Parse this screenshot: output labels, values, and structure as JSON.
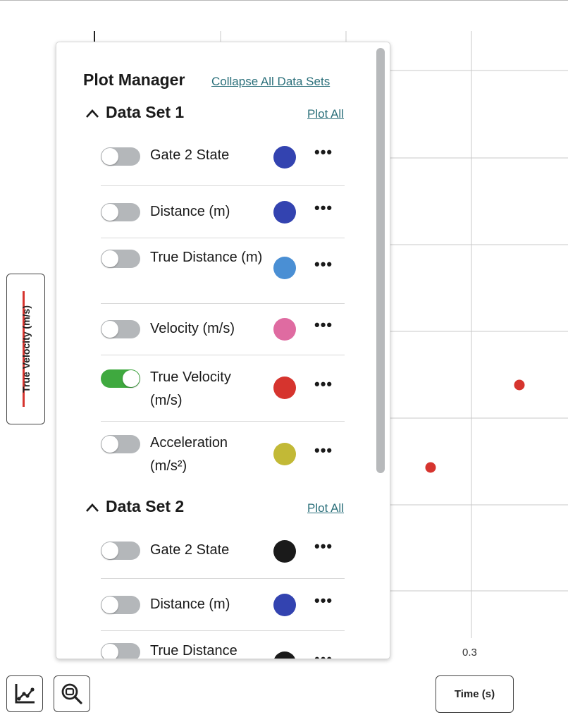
{
  "plot": {
    "x_tick_label": "0.3",
    "y_axis_label": "True Velocity (m/s)",
    "x_axis_label": "Time (s)",
    "series_color": "#d6342e",
    "point_color": "#d6342e"
  },
  "chart_data": {
    "type": "scatter",
    "xlabel": "Time (s)",
    "ylabel": "True Velocity (m/s)",
    "x_ticks": [
      "0.3"
    ],
    "series": [
      {
        "name": "True Velocity (m/s)",
        "color": "#d6342e",
        "points": [
          {
            "x": 0.28
          },
          {
            "x": 0.32
          }
        ]
      }
    ]
  },
  "plot_manager": {
    "title": "Plot Manager",
    "collapse_all_label": "Collapse All Data Sets",
    "datasets": [
      {
        "name": "Data Set 1",
        "plot_all_label": "Plot All",
        "expanded": true,
        "rows": [
          {
            "label": "Gate 2 State",
            "color": "#3343b0",
            "on": false
          },
          {
            "label": "Distance (m)",
            "color": "#3343b0",
            "on": false
          },
          {
            "label": "True Distance (m)",
            "color": "#4a8fd4",
            "on": false
          },
          {
            "label": "Velocity (m/s)",
            "color": "#df6ba1",
            "on": false
          },
          {
            "label": "True Velocity (m/s)",
            "color": "#d6342e",
            "on": true
          },
          {
            "label": "Acceleration (m/s²)",
            "color": "#c2b936",
            "on": false
          }
        ]
      },
      {
        "name": "Data Set 2",
        "plot_all_label": "Plot All",
        "expanded": true,
        "rows": [
          {
            "label": "Gate 2 State",
            "color": "#1a1a1a",
            "on": false
          },
          {
            "label": "Distance (m)",
            "color": "#3343b0",
            "on": false
          },
          {
            "label": "True Distance",
            "color": "#1a1a1a",
            "on": false
          }
        ]
      }
    ]
  },
  "toolbar": {
    "icons": [
      "line-chart-icon",
      "zoom-fit-icon"
    ]
  }
}
